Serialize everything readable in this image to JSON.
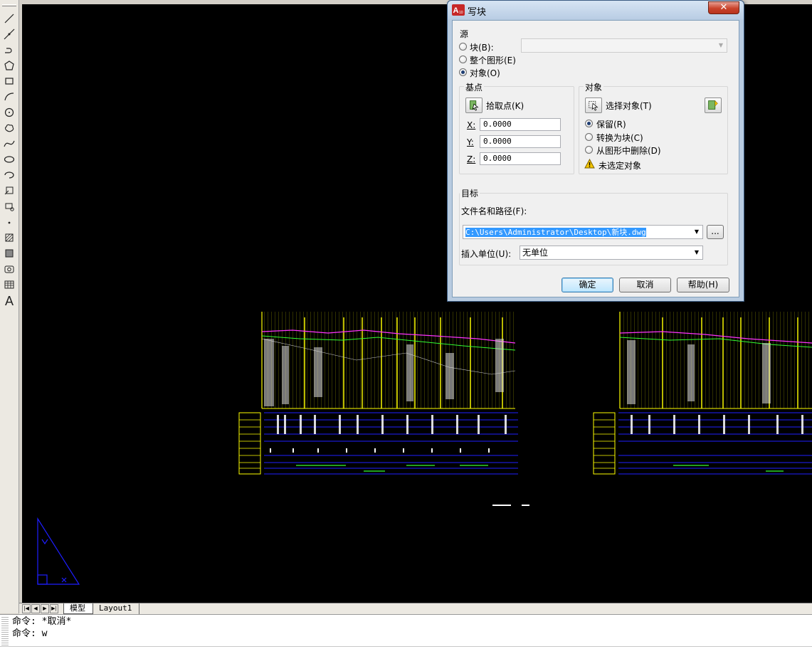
{
  "dialog": {
    "title": "写块",
    "close_label": "✕",
    "source": {
      "group_label": "源",
      "options": [
        {
          "label": "块(B):",
          "checked": false
        },
        {
          "label": "整个图形(E)",
          "checked": false
        },
        {
          "label": "对象(O)",
          "checked": true
        }
      ],
      "block_combo_value": ""
    },
    "base_point": {
      "group_label": "基点",
      "pick_label": "拾取点(K)",
      "x_label": "X:",
      "y_label": "Y:",
      "z_label": "Z:",
      "x": "0.0000",
      "y": "0.0000",
      "z": "0.0000"
    },
    "objects": {
      "group_label": "对象",
      "select_label": "选择对象(T)",
      "options": [
        {
          "label": "保留(R)",
          "checked": true
        },
        {
          "label": "转换为块(C)",
          "checked": false
        },
        {
          "label": "从图形中删除(D)",
          "checked": false
        }
      ],
      "warning": "未选定对象"
    },
    "target": {
      "group_label": "目标",
      "path_label": "文件名和路径(F):",
      "path_value": "C:\\Users\\Administrator\\Desktop\\新块.dwg",
      "browse_label": "...",
      "units_label": "插入单位(U):",
      "units_value": "无单位"
    },
    "buttons": {
      "ok": "确定",
      "cancel": "取消",
      "help": "帮助(H)"
    }
  },
  "tabs": [
    {
      "label": "模型",
      "active": true
    },
    {
      "label": "Layout1",
      "active": false
    }
  ],
  "command_lines": [
    "命令: *取消*",
    "命令: w"
  ],
  "colors": {
    "canvas": "#000000",
    "drawing_yellow": "#ffff00",
    "drawing_blue": "#0000ff",
    "annotation_arrow": "#e53935",
    "ucs_icon": "#0000ff"
  },
  "icons": {
    "close": "close-icon",
    "pick_point": "pick-point-icon",
    "select_objects": "select-objects-icon",
    "quick_select": "quick-select-icon",
    "warning": "warning-icon"
  }
}
